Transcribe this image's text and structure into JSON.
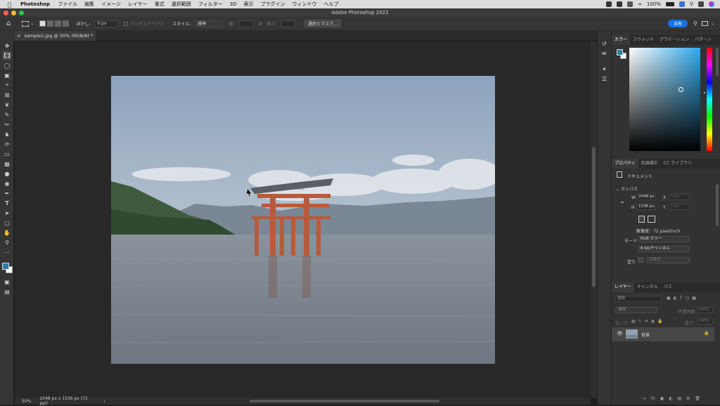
{
  "menubar": {
    "app_name": "Photoshop",
    "items": [
      "ファイル",
      "編集",
      "イメージ",
      "レイヤー",
      "書式",
      "選択範囲",
      "フィルター",
      "3D",
      "表示",
      "プラグイン",
      "ウィンドウ",
      "ヘルプ"
    ],
    "battery": "100%"
  },
  "window": {
    "title": "Adobe Photoshop 2022"
  },
  "options": {
    "feather_label": "ぼかし：",
    "feather_value": "0 px",
    "antialias_label": "アンチエイリアス",
    "style_label": "スタイル：",
    "style_value": "標準",
    "width_label": "幅：",
    "height_label": "高さ：",
    "select_mask_button": "選択とマスク...",
    "share_button": "共有"
  },
  "document": {
    "tab_label": "sample2.jpg @ 50% (RGB/8) *",
    "zoom": "50%",
    "doc_info": "2048 px x 1536 px (72 ppi)"
  },
  "color_panel": {
    "tabs": [
      "カラー",
      "スウォッチ",
      "グラデーション",
      "パターン"
    ],
    "foreground_color": "#2a7ea6",
    "background_color": "#ffffff"
  },
  "properties_panel": {
    "tabs": [
      "プロパティ",
      "色調補正",
      "CC ライブラリ"
    ],
    "doc_type": "ドキュメント",
    "section": "カンバス",
    "w_label": "W",
    "w_value": "2048 px",
    "x_label": "X",
    "x_placeholder": "0 px",
    "h_label": "H",
    "h_value": "1536 px",
    "y_label": "Y",
    "y_placeholder": "0 px",
    "resolution": "解像度：72 pixel/inch",
    "mode_label": "モード",
    "mode_value": "RGB カラー",
    "bit_value": "8 bit/チャンネル",
    "fill_label": "塗り",
    "fill_value": "背景色"
  },
  "layers_panel": {
    "tabs": [
      "レイヤー",
      "チャンネル",
      "パス"
    ],
    "search_placeholder": "種類",
    "blend_mode": "通常",
    "opacity_label": "不透明度：",
    "opacity_value": "100%",
    "lock_label": "ロック：",
    "fill_label": "塗り：",
    "fill_value": "100%",
    "layer_name": "背景"
  }
}
